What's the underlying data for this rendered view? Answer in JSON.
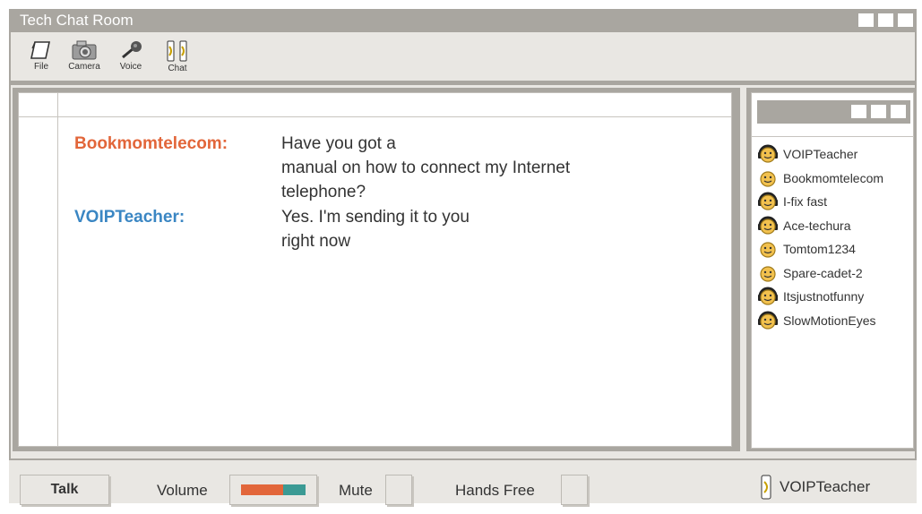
{
  "window": {
    "title": "Tech Chat Room"
  },
  "toolbar": {
    "file_label": "File",
    "camera_label": "Camera",
    "voice_label": "Voice",
    "chat_label": "Chat"
  },
  "chat": {
    "messages": [
      {
        "sender": "Bookmomtelecom:",
        "sender_color": "#e2663a",
        "lines": [
          "Have you got a",
          "manual on how to connect my Internet",
          "telephone?"
        ]
      },
      {
        "sender": "VOIPTeacher:",
        "sender_color": "#3a86c3",
        "lines": [
          "Yes. I'm sending it to you",
          "right now"
        ]
      }
    ]
  },
  "users": [
    {
      "name": "VOIPTeacher",
      "icon": "smiley-headset-icon"
    },
    {
      "name": "Bookmomtelecom",
      "icon": "smiley-icon"
    },
    {
      "name": "I-fix fast",
      "icon": "smiley-headset-icon"
    },
    {
      "name": "Ace-techura",
      "icon": "smiley-headset-icon"
    },
    {
      "name": "Tomtom1234",
      "icon": "smiley-icon"
    },
    {
      "name": "Spare-cadet-2",
      "icon": "smiley-icon"
    },
    {
      "name": "Itsjustnotfunny",
      "icon": "smiley-headset-icon"
    },
    {
      "name": "SlowMotionEyes",
      "icon": "smiley-headset-icon"
    }
  ],
  "bottom": {
    "talk_label": "Talk",
    "volume_label": "Volume",
    "volume_level": 0.65,
    "mute_label": "Mute",
    "handsfree_label": "Hands Free",
    "current_user": "VOIPTeacher"
  },
  "colors": {
    "frame": "#a9a6a0",
    "volume_orange": "#e2663a",
    "volume_teal": "#3b9a94",
    "smiley_yellow": "#f2c14e"
  }
}
